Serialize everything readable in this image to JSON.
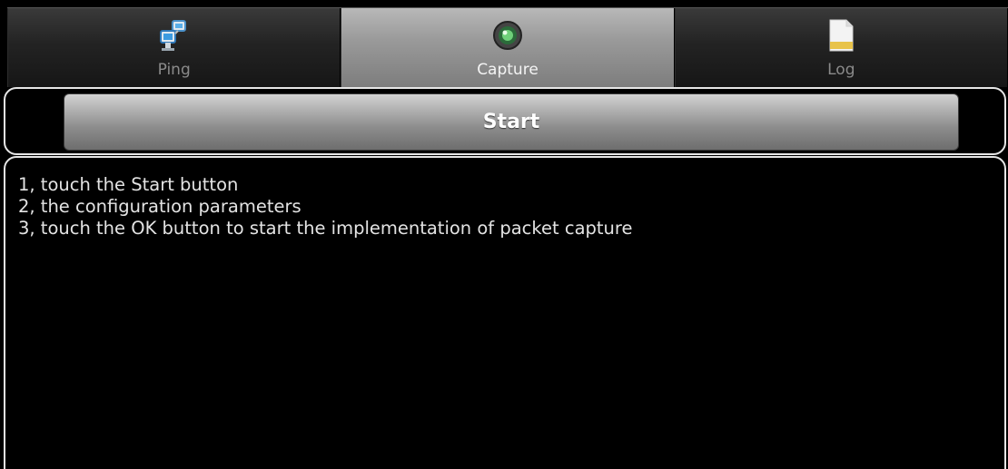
{
  "tabs": [
    {
      "label": "Ping",
      "icon": "ping-network-icon",
      "selected": false
    },
    {
      "label": "Capture",
      "icon": "capture-camera-icon",
      "selected": true
    },
    {
      "label": "Log",
      "icon": "log-file-icon",
      "selected": false
    }
  ],
  "start_button": {
    "label": "Start"
  },
  "instructions": [
    "1, touch the Start button",
    "2, the configuration parameters",
    "3, touch the OK button to start the implementation of packet capture"
  ],
  "colors": {
    "background": "#000000",
    "selected_tab": "#9a9a9a",
    "panel_border": "#e6e6e6"
  }
}
